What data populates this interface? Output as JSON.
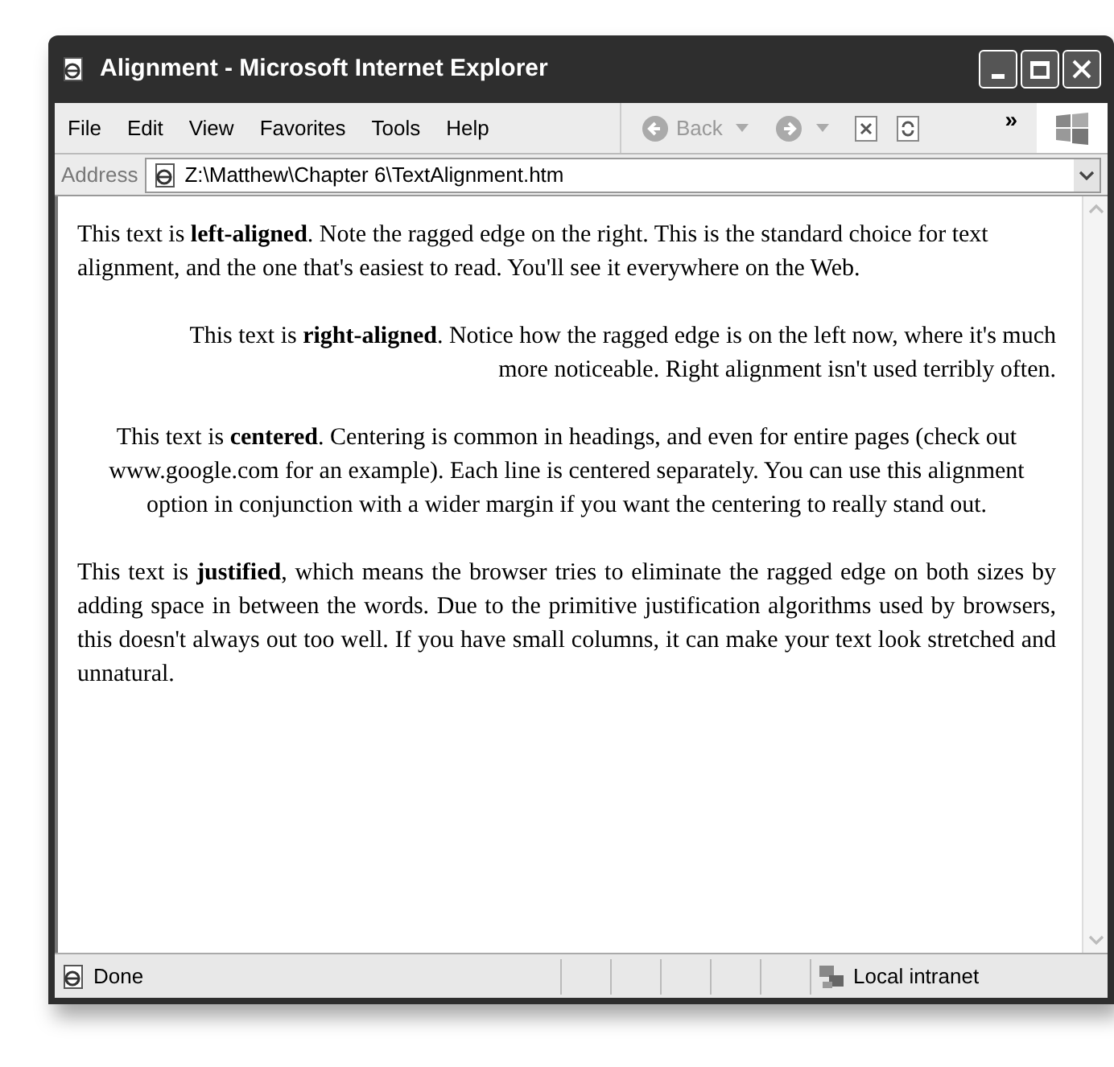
{
  "window": {
    "title": "Alignment - Microsoft Internet Explorer"
  },
  "menu": [
    "File",
    "Edit",
    "View",
    "Favorites",
    "Tools",
    "Help"
  ],
  "toolbar": {
    "back": "Back",
    "more": "»"
  },
  "address": {
    "label": "Address",
    "value": "Z:\\Matthew\\Chapter 6\\TextAlignment.htm"
  },
  "paragraphs": [
    {
      "kind": "left",
      "text": "This text is **left-aligned**. Note the ragged edge on the right. This is the standard choice for text alignment, and the one that's easiest to read. You'll see it everywhere on the Web."
    },
    {
      "kind": "right",
      "text": "This text is **right-aligned**. Notice how the ragged edge is on the left now, where it's much more noticeable. Right alignment isn't used terribly often."
    },
    {
      "kind": "center",
      "text": "This text is **centered**. Centering is common in headings, and even for entire pages (check out www.google.com for an example). Each line is centered separately. You can use this alignment option in conjunction with a wider margin if you want the centering to really stand out."
    },
    {
      "kind": "justify",
      "text": "This text is **justified**, which means the browser tries to eliminate the ragged edge on both sizes by adding space in between the words. Due to the primitive justification algorithms used by browsers, this doesn't always out too well. If you have small columns, it can make your text look stretched and unnatural."
    }
  ],
  "status_bar": {
    "text": "Done",
    "zone": "Local intranet"
  }
}
